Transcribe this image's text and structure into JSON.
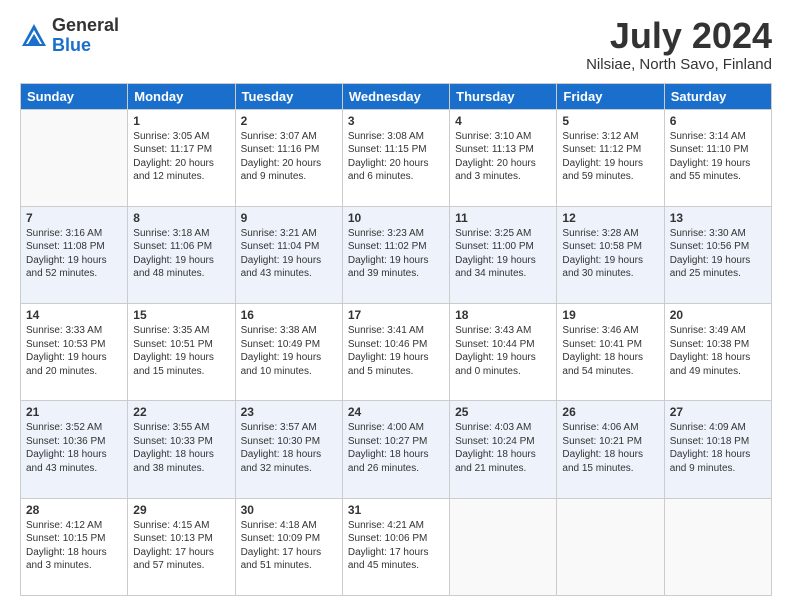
{
  "logo": {
    "general": "General",
    "blue": "Blue"
  },
  "title": "July 2024",
  "location": "Nilsiae, North Savo, Finland",
  "days_of_week": [
    "Sunday",
    "Monday",
    "Tuesday",
    "Wednesday",
    "Thursday",
    "Friday",
    "Saturday"
  ],
  "weeks": [
    [
      {
        "day": "",
        "info": ""
      },
      {
        "day": "1",
        "info": "Sunrise: 3:05 AM\nSunset: 11:17 PM\nDaylight: 20 hours\nand 12 minutes."
      },
      {
        "day": "2",
        "info": "Sunrise: 3:07 AM\nSunset: 11:16 PM\nDaylight: 20 hours\nand 9 minutes."
      },
      {
        "day": "3",
        "info": "Sunrise: 3:08 AM\nSunset: 11:15 PM\nDaylight: 20 hours\nand 6 minutes."
      },
      {
        "day": "4",
        "info": "Sunrise: 3:10 AM\nSunset: 11:13 PM\nDaylight: 20 hours\nand 3 minutes."
      },
      {
        "day": "5",
        "info": "Sunrise: 3:12 AM\nSunset: 11:12 PM\nDaylight: 19 hours\nand 59 minutes."
      },
      {
        "day": "6",
        "info": "Sunrise: 3:14 AM\nSunset: 11:10 PM\nDaylight: 19 hours\nand 55 minutes."
      }
    ],
    [
      {
        "day": "7",
        "info": "Sunrise: 3:16 AM\nSunset: 11:08 PM\nDaylight: 19 hours\nand 52 minutes."
      },
      {
        "day": "8",
        "info": "Sunrise: 3:18 AM\nSunset: 11:06 PM\nDaylight: 19 hours\nand 48 minutes."
      },
      {
        "day": "9",
        "info": "Sunrise: 3:21 AM\nSunset: 11:04 PM\nDaylight: 19 hours\nand 43 minutes."
      },
      {
        "day": "10",
        "info": "Sunrise: 3:23 AM\nSunset: 11:02 PM\nDaylight: 19 hours\nand 39 minutes."
      },
      {
        "day": "11",
        "info": "Sunrise: 3:25 AM\nSunset: 11:00 PM\nDaylight: 19 hours\nand 34 minutes."
      },
      {
        "day": "12",
        "info": "Sunrise: 3:28 AM\nSunset: 10:58 PM\nDaylight: 19 hours\nand 30 minutes."
      },
      {
        "day": "13",
        "info": "Sunrise: 3:30 AM\nSunset: 10:56 PM\nDaylight: 19 hours\nand 25 minutes."
      }
    ],
    [
      {
        "day": "14",
        "info": "Sunrise: 3:33 AM\nSunset: 10:53 PM\nDaylight: 19 hours\nand 20 minutes."
      },
      {
        "day": "15",
        "info": "Sunrise: 3:35 AM\nSunset: 10:51 PM\nDaylight: 19 hours\nand 15 minutes."
      },
      {
        "day": "16",
        "info": "Sunrise: 3:38 AM\nSunset: 10:49 PM\nDaylight: 19 hours\nand 10 minutes."
      },
      {
        "day": "17",
        "info": "Sunrise: 3:41 AM\nSunset: 10:46 PM\nDaylight: 19 hours\nand 5 minutes."
      },
      {
        "day": "18",
        "info": "Sunrise: 3:43 AM\nSunset: 10:44 PM\nDaylight: 19 hours\nand 0 minutes."
      },
      {
        "day": "19",
        "info": "Sunrise: 3:46 AM\nSunset: 10:41 PM\nDaylight: 18 hours\nand 54 minutes."
      },
      {
        "day": "20",
        "info": "Sunrise: 3:49 AM\nSunset: 10:38 PM\nDaylight: 18 hours\nand 49 minutes."
      }
    ],
    [
      {
        "day": "21",
        "info": "Sunrise: 3:52 AM\nSunset: 10:36 PM\nDaylight: 18 hours\nand 43 minutes."
      },
      {
        "day": "22",
        "info": "Sunrise: 3:55 AM\nSunset: 10:33 PM\nDaylight: 18 hours\nand 38 minutes."
      },
      {
        "day": "23",
        "info": "Sunrise: 3:57 AM\nSunset: 10:30 PM\nDaylight: 18 hours\nand 32 minutes."
      },
      {
        "day": "24",
        "info": "Sunrise: 4:00 AM\nSunset: 10:27 PM\nDaylight: 18 hours\nand 26 minutes."
      },
      {
        "day": "25",
        "info": "Sunrise: 4:03 AM\nSunset: 10:24 PM\nDaylight: 18 hours\nand 21 minutes."
      },
      {
        "day": "26",
        "info": "Sunrise: 4:06 AM\nSunset: 10:21 PM\nDaylight: 18 hours\nand 15 minutes."
      },
      {
        "day": "27",
        "info": "Sunrise: 4:09 AM\nSunset: 10:18 PM\nDaylight: 18 hours\nand 9 minutes."
      }
    ],
    [
      {
        "day": "28",
        "info": "Sunrise: 4:12 AM\nSunset: 10:15 PM\nDaylight: 18 hours\nand 3 minutes."
      },
      {
        "day": "29",
        "info": "Sunrise: 4:15 AM\nSunset: 10:13 PM\nDaylight: 17 hours\nand 57 minutes."
      },
      {
        "day": "30",
        "info": "Sunrise: 4:18 AM\nSunset: 10:09 PM\nDaylight: 17 hours\nand 51 minutes."
      },
      {
        "day": "31",
        "info": "Sunrise: 4:21 AM\nSunset: 10:06 PM\nDaylight: 17 hours\nand 45 minutes."
      },
      {
        "day": "",
        "info": ""
      },
      {
        "day": "",
        "info": ""
      },
      {
        "day": "",
        "info": ""
      }
    ]
  ]
}
